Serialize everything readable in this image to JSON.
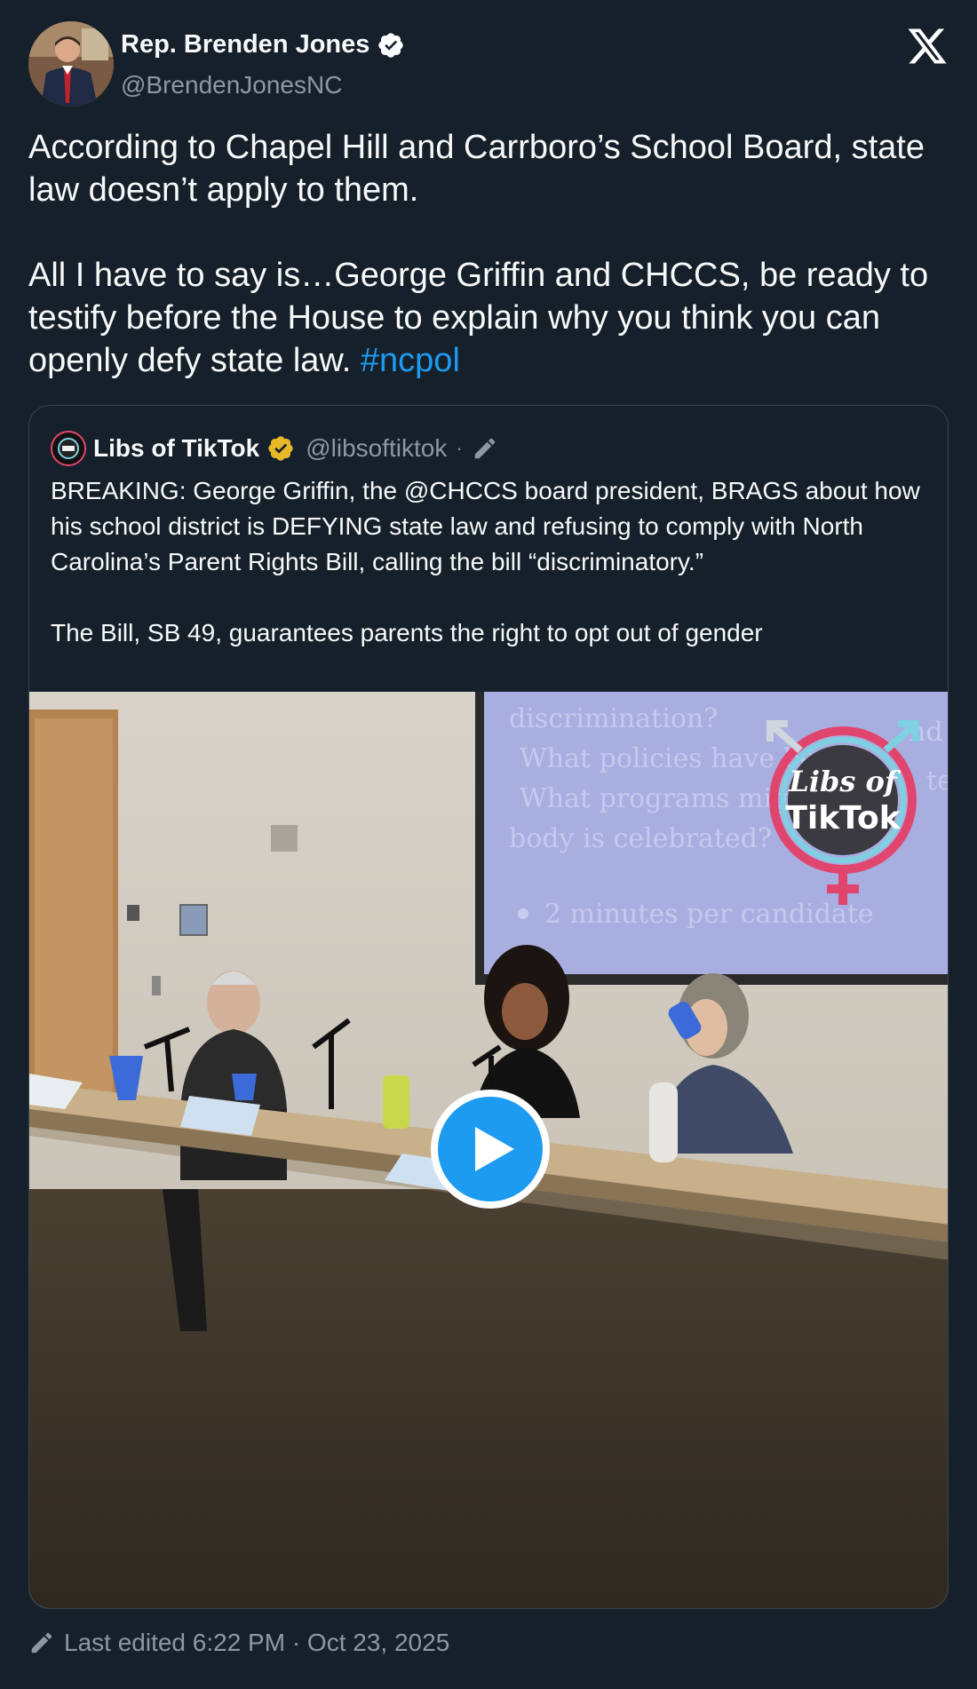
{
  "author": {
    "name": "Rep. Brenden Jones",
    "handle": "@BrendenJonesNC"
  },
  "tweet": {
    "text": "According to Chapel Hill and Carrboro’s School Board, state law doesn’t apply to them.\n\nAll I have to say is…George Griffin and CHCCS, be ready to testify before the House to explain why you think you can openly defy state law. ",
    "hashtag": "#ncpol"
  },
  "quoted_tweet": {
    "name": "Libs of TikTok",
    "handle": "@libsoftiktok",
    "dot": "·",
    "text": "BREAKING: George Griffin, the @CHCCS board president, BRAGS about how his school district is DEFYING state law and refusing to comply with North Carolina’s Parent Rights Bill, calling the bill “discriminatory.”\n\nThe Bill, SB 49, guarantees parents the right to opt out of gender",
    "video": {
      "slide_lines": [
        "discrimination?",
        "What policies have been",
        "What programs might h",
        "body is celebrated?",
        "2 minutes per candidate"
      ],
      "watermark_line1": "Libs of",
      "watermark_line2": "TikTok",
      "cut_text_right1": "nd",
      "cut_text_right2": "te"
    }
  },
  "footer": {
    "edited_label": "Last edited 6:22 PM · Oct 23, 2025"
  },
  "colors": {
    "background": "#15202b",
    "accent": "#1d9bf0",
    "muted": "#8b98a5",
    "verified_gold": "#e8b829"
  }
}
